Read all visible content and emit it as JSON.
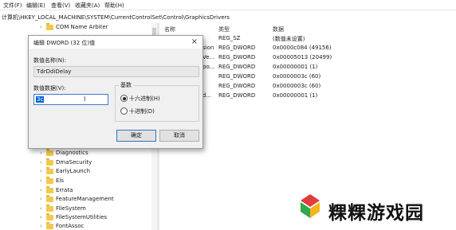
{
  "menubar": {
    "items": [
      "文件(F)",
      "编辑(E)",
      "查看(V)",
      "收藏夹(A)",
      "帮助(H)"
    ]
  },
  "address": {
    "path": "计算机\\HKEY_LOCAL_MACHINE\\SYSTEM\\CurrentControlSet\\Control\\GraphicsDrivers"
  },
  "tree": {
    "items": [
      {
        "label": "COM Name Arbiter"
      },
      {
        "label": "Diagnostics"
      },
      {
        "label": "DmaSecurity"
      },
      {
        "label": "EarlyLaunch"
      },
      {
        "label": "Els"
      },
      {
        "label": "Errata"
      },
      {
        "label": "FeatureManagement"
      },
      {
        "label": "FileSystem"
      },
      {
        "label": "FileSystemUtilities"
      },
      {
        "label": "FontAssoc"
      }
    ]
  },
  "list": {
    "headers": {
      "name": "名称",
      "type": "类型",
      "data": "数据"
    },
    "rows": [
      {
        "name": "",
        "type": "REG_SZ",
        "data": "(数值未设置)"
      },
      {
        "name": "sion",
        "type": "REG_DWORD",
        "data": "0x0000c084 (49156)"
      },
      {
        "name": "Ve...",
        "type": "REG_DWORD",
        "data": "0x00005013 (20499)"
      },
      {
        "name": "po...",
        "type": "REG_DWORD",
        "data": "0x00000001 (1)"
      },
      {
        "name": "",
        "type": "REG_DWORD",
        "data": "0x0000003c (60)"
      },
      {
        "name": "",
        "type": "REG_DWORD",
        "data": "0x0000003c (60)"
      },
      {
        "name": "d...",
        "type": "REG_DWORD",
        "data": "0x00000001 (1)"
      }
    ]
  },
  "dialog": {
    "title": "编辑 DWORD (32 位)值",
    "close": "×",
    "name_label": "数值名称(N):",
    "name_value": "TdrDdiDelay",
    "data_label": "数值数据(V):",
    "data_value": "3c",
    "base_label": "基数",
    "radio_hex": "十六进制(H)",
    "radio_dec": "十进制(D)",
    "ok": "确定",
    "cancel": "取消",
    "selected_base": "hex"
  },
  "watermark": {
    "text": "粿粿游戏园"
  },
  "colors": {
    "folder": "#f2c94c",
    "selection": "#0a64d2",
    "accent_border": "#2e74c9"
  }
}
